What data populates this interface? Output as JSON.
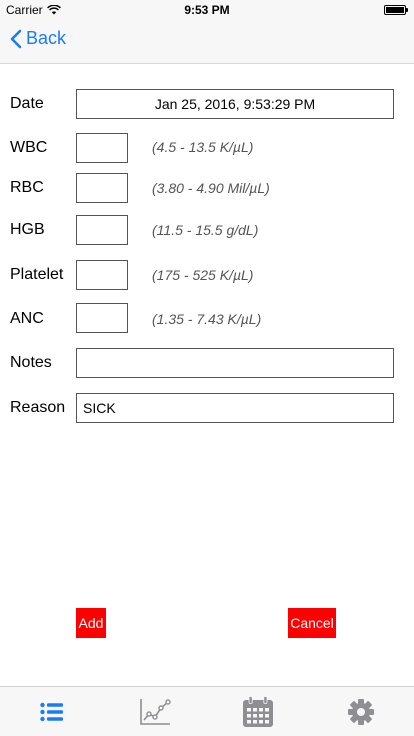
{
  "status_bar": {
    "carrier": "Carrier",
    "time": "9:53 PM"
  },
  "nav": {
    "back_label": "Back",
    "back_icon": "chevron-left-icon"
  },
  "form": {
    "date": {
      "label": "Date",
      "value": "Jan 25, 2016, 9:53:29 PM"
    },
    "wbc": {
      "label": "WBC",
      "value": "",
      "range": "(4.5 - 13.5 K/µL)"
    },
    "rbc": {
      "label": "RBC",
      "value": "",
      "range": "(3.80 - 4.90 Mil/µL)"
    },
    "hgb": {
      "label": "HGB",
      "value": "",
      "range": "(11.5 - 15.5 g/dL)"
    },
    "platelet": {
      "label": "Platelet",
      "value": "",
      "range": "(175 - 525 K/µL)"
    },
    "anc": {
      "label": "ANC",
      "value": "",
      "range": "(1.35 - 7.43 K/µL)"
    },
    "notes": {
      "label": "Notes",
      "value": ""
    },
    "reason": {
      "label": "Reason",
      "value": "SICK"
    }
  },
  "actions": {
    "add_label": "Add",
    "cancel_label": "Cancel"
  },
  "tabs": [
    {
      "icon": "list-icon",
      "active": true
    },
    {
      "icon": "chart-icon",
      "active": false
    },
    {
      "icon": "calendar-icon",
      "active": false
    },
    {
      "icon": "gear-icon",
      "active": false
    }
  ],
  "colors": {
    "accent": "#1a7cf5",
    "button": "#ff0000",
    "inactive_icon": "#8e8e93"
  }
}
